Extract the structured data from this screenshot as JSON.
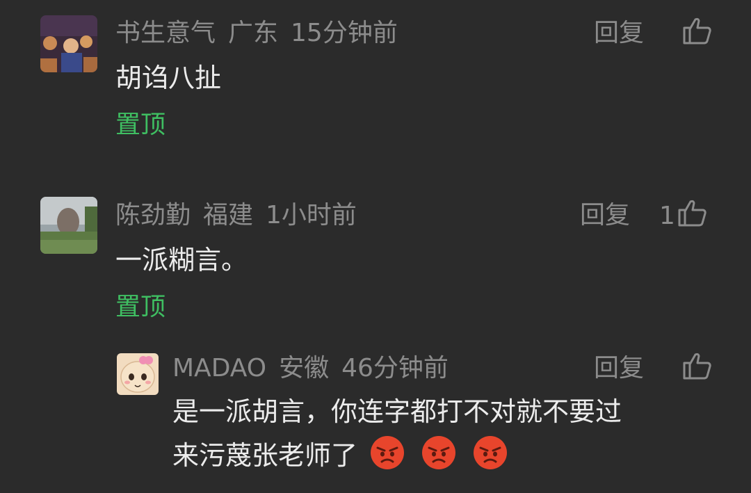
{
  "comments": [
    {
      "author": "书生意气",
      "region": "广东",
      "time": "15分钟前",
      "reply_label": "回复",
      "like_count": "",
      "text": "胡诌八扯",
      "pin_label": "置顶"
    },
    {
      "author": "陈劲勤",
      "region": "福建",
      "time": "1小时前",
      "reply_label": "回复",
      "like_count": "1",
      "text": "一派糊言。",
      "pin_label": "置顶"
    }
  ],
  "reply": {
    "author": "MADAO",
    "region": "安徽",
    "time": "46分钟前",
    "reply_label": "回复",
    "like_count": "",
    "text_line1": "是一派胡言，你连字都打不对就不要过",
    "text_line2": "来污蔑张老师了",
    "emojis": [
      "angry-face-emoji",
      "angry-face-emoji",
      "angry-face-emoji"
    ]
  },
  "colors": {
    "background": "#2b2b2b",
    "meta_text": "#8c8c8c",
    "body_text": "#ececec",
    "pin_green": "#3fbf62",
    "emoji_red": "#e8452c"
  }
}
